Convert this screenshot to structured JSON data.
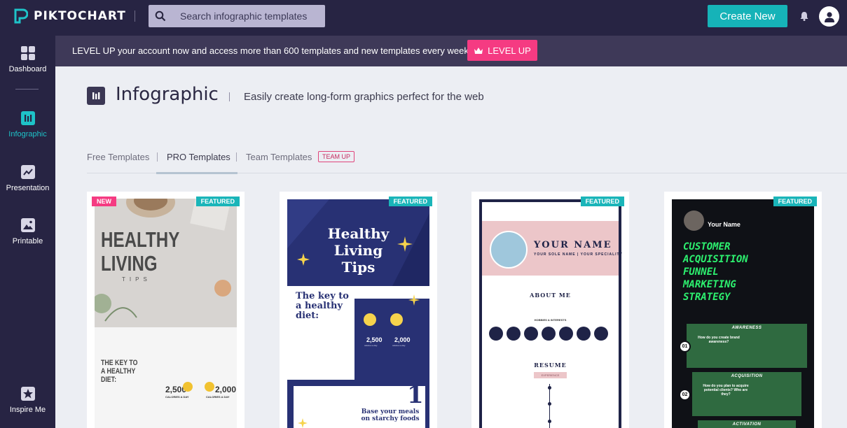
{
  "app": {
    "logo_text": "PIKTOCHART",
    "search_placeholder": "Search infographic templates",
    "create_new": "Create New"
  },
  "sidebar": {
    "items": [
      {
        "label": "Dashboard",
        "icon": "grid-icon"
      },
      {
        "label": "Infographic",
        "icon": "infographic-icon",
        "active": true
      },
      {
        "label": "Presentation",
        "icon": "presentation-icon"
      },
      {
        "label": "Printable",
        "icon": "image-icon"
      },
      {
        "label": "Inspire Me",
        "icon": "star-icon"
      }
    ]
  },
  "banner": {
    "text": "LEVEL UP your account now and access more than 600 templates and new templates every week.",
    "button": "LEVEL UP"
  },
  "header": {
    "title": "Infographic",
    "subtitle": "Easily create long-form graphics perfect for the web"
  },
  "tabs": [
    {
      "label": "Free Templates"
    },
    {
      "label": "PRO Templates",
      "active": true
    },
    {
      "label": "Team Templates"
    }
  ],
  "team_badge": "TEAM UP",
  "cards": [
    {
      "badges": [
        "NEW",
        "FEATURED"
      ],
      "title": "HEALTHY LIVING",
      "subtitle": "TIPS",
      "section": "THE KEY TO A HEALTHY DIET:",
      "stat1": "2,500",
      "stat2": "2,000",
      "stat_label": "CALORIES A DAY"
    },
    {
      "badges": [
        "FEATURED"
      ],
      "title": "Healthy Living Tips",
      "section": "The key to a healthy diet:",
      "stat1": "2,500",
      "stat2": "2,000",
      "stat_label": "calories a day",
      "bottom_number": "1",
      "bottom_text": "Base your meals on starchy foods"
    },
    {
      "badges": [
        "FEATURED"
      ],
      "name": "YOUR NAME",
      "role": "YOUR SOLE NAME | YOUR SPECIALITY",
      "about": "ABOUT ME",
      "hobbies": "HOBBIES & INTERESTS",
      "resume": "RESUME",
      "experience": "EXPERIENCE"
    },
    {
      "badges": [
        "FEATURED"
      ],
      "author": "Your Name",
      "title": "CUSTOMER ACQUISITION FUNNEL MARKETING STRATEGY",
      "stages": [
        {
          "step": "01",
          "name": "AWARENESS",
          "question": "How do you create brand awareness?"
        },
        {
          "step": "02",
          "name": "ACQUISITION",
          "question": "How do you plan to acquire potential clients? Who are they?"
        },
        {
          "name": "ACTIVATION"
        }
      ]
    }
  ],
  "colors": {
    "nav_bg": "#272443",
    "accent_teal": "#16b3b8",
    "accent_pink": "#f53b82",
    "content_bg": "#eceef3"
  }
}
